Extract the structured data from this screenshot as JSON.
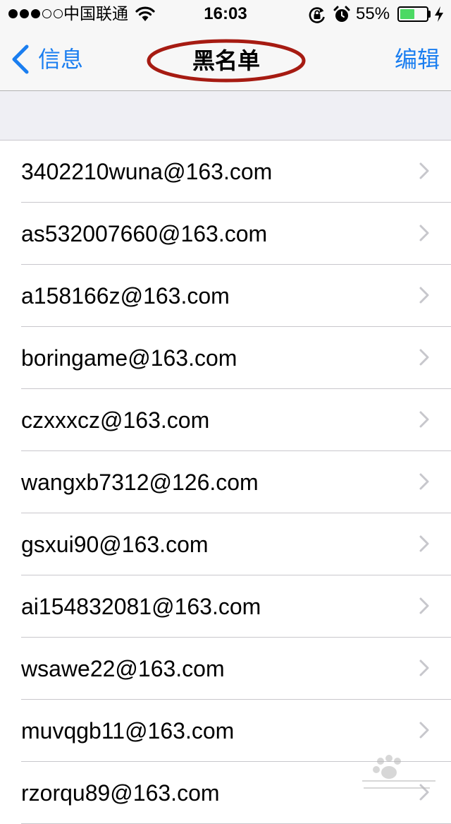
{
  "status_bar": {
    "carrier": "中国联通",
    "time": "16:03",
    "battery_percent_text": "55%",
    "battery_level": 0.55,
    "signal_strength": 3,
    "signal_max": 5
  },
  "nav": {
    "back_label": "信息",
    "title": "黑名单",
    "edit_label": "编辑"
  },
  "blocked_list": [
    "3402210wuna@163.com",
    "as532007660@163.com",
    "a158166z@163.com",
    "boringame@163.com",
    "czxxxcz@163.com",
    "wangxb7312@126.com",
    "gsxui90@163.com",
    "ai154832081@163.com",
    "wsawe22@163.com",
    "muvqgb11@163.com",
    "rzorqu89@163.com"
  ],
  "colors": {
    "accent": "#1a7ef0",
    "title_annotation": "#a61b12",
    "battery_fill": "#4cd964"
  },
  "icons": {
    "back": "chevron-left-icon",
    "row": "chevron-right-icon",
    "wifi": "wifi-icon",
    "rotation_lock": "rotation-lock-icon",
    "alarm": "alarm-icon",
    "charging": "bolt-icon"
  }
}
